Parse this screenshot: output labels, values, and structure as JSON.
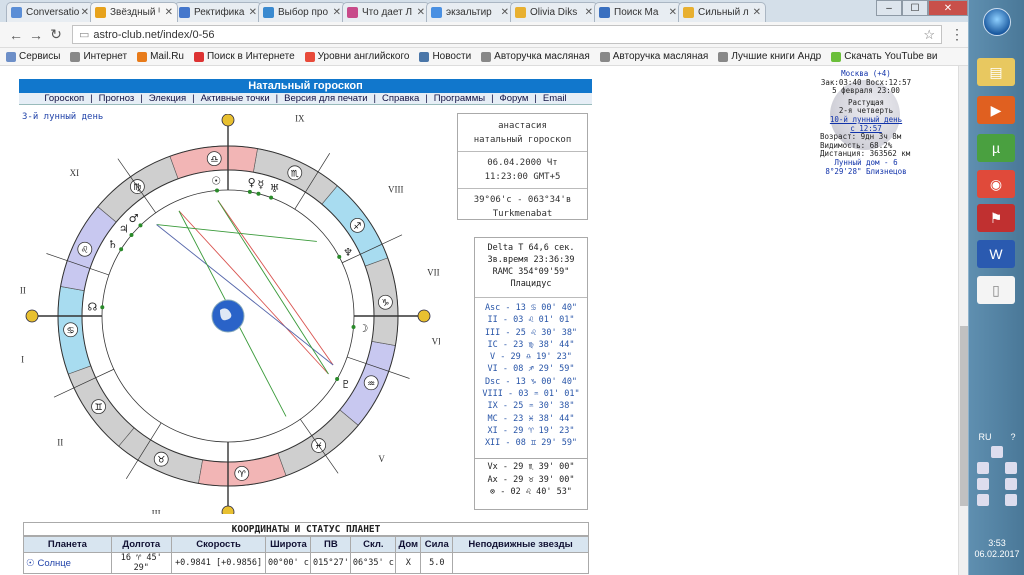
{
  "browser": {
    "tabs": [
      {
        "title": "Conversatio",
        "color": "#5b8ed6",
        "active": false
      },
      {
        "title": "Звёздный ᴵ",
        "color": "#e7a21c",
        "active": true
      },
      {
        "title": "Ректифика",
        "color": "#4477cc",
        "active": false
      },
      {
        "title": "Выбор про",
        "color": "#3a8ad0",
        "active": false
      },
      {
        "title": "Что дает Л",
        "color": "#c84a8a",
        "active": false
      },
      {
        "title": "экзальтир",
        "color": "#4a90e2",
        "active": false
      },
      {
        "title": "Olivia Diks",
        "color": "#e8b030",
        "active": false
      },
      {
        "title": "Поиск Ма",
        "color": "#3a70c0",
        "active": false
      },
      {
        "title": "Сильный л",
        "color": "#e8b030",
        "active": false
      }
    ],
    "url": "astro-club.net/index/0-56",
    "bookmarks": [
      {
        "label": "Сервисы",
        "color": "#6d8fc8"
      },
      {
        "label": "Интернет",
        "color": "#888888"
      },
      {
        "label": "Mail.Ru",
        "color": "#e87b1a"
      },
      {
        "label": "Поиск в Интернете",
        "color": "#d33"
      },
      {
        "label": "Уровни английского",
        "color": "#e84a3a"
      },
      {
        "label": "Новости",
        "color": "#4a76a8"
      },
      {
        "label": "Авторучка масляная",
        "color": "#888888"
      },
      {
        "label": "Авторучка масляная",
        "color": "#888888"
      },
      {
        "label": "Лучшие книги Андр",
        "color": "#888888"
      },
      {
        "label": "Скачать YouTube ви",
        "color": "#6bbf3a"
      }
    ],
    "window_buttons": {
      "minimize": "–",
      "maximize": "☐",
      "close": "✕"
    }
  },
  "page": {
    "title": "Натальный гороскоп",
    "nav": [
      "Гороскоп",
      "Прогноз",
      "Элекция",
      "Активные точки",
      "Версия для печати",
      "Справка",
      "Программы",
      "Форум",
      "Email"
    ],
    "lunar_day": "3-й лунный день",
    "info": {
      "name": "анастасия",
      "type": "натальный гороскоп",
      "date": "06.04.2000 Чт",
      "time": "11:23:00  GMT+5",
      "coords": "39°06'с - 063°34'в",
      "place": "Turkmenabat"
    },
    "delta": {
      "delta_t": "Delta T  64,6 сек.",
      "star_time": "Зв.время 23:36:39",
      "ramc": "RAMC 354°09'59\"",
      "system": "Плацидус"
    },
    "cusps": [
      "Asc - 13 ♋ 00' 40\"",
      "II - 03 ♌ 01' 01\"",
      "III - 25 ♌ 30' 38\"",
      "IC - 23 ♍ 38' 44\"",
      "V - 29 ♎ 19' 23\"",
      "VI - 08 ♐ 29' 59\"",
      "Dsc - 13 ♑ 00' 40\"",
      "VIII - 03 ♒ 01' 01\"",
      "IX - 25 ♒ 30' 38\"",
      "MC - 23 ♓ 38' 44\"",
      "XI - 29 ♈ 19' 23\"",
      "XII - 08 ♊ 29' 59\""
    ],
    "aspects": [
      "Vx - 29 ♏ 39' 00\"",
      "Ax - 29 ♉ 39' 00\"",
      "⊗ - 02 ♌ 40' 53\""
    ],
    "coord_title": "КООРДИНАТЫ И СТАТУС ПЛАНЕТ",
    "coord_headers": [
      "Планета",
      "Долгота",
      "Скорость",
      "Широта",
      "ПВ",
      "Скл.",
      "Дом",
      "Сила",
      "Неподвижные звезды"
    ],
    "coord_rows": [
      {
        "planet": "Солнце",
        "glyph": "☉",
        "lon": "16 ♈ 45' 29\"",
        "speed": "+0.9841 [+0.9856]",
        "lat": "00°00' с",
        "ra": "015°27'",
        "decl": "06°35' с",
        "house": "X",
        "power": "5.0",
        "stars": ""
      }
    ]
  },
  "chart": {
    "houses": [
      "I",
      "II",
      "III",
      "IV",
      "V",
      "VI",
      "VII",
      "VIII",
      "IX",
      "X",
      "XI",
      "XII"
    ],
    "zodiac": [
      "♋",
      "♊",
      "♉",
      "♈",
      "♓",
      "♒",
      "♑",
      "♐",
      "♏",
      "♎",
      "♍",
      "♌"
    ],
    "house_colors": {
      "fire": "#f2b5b5",
      "earth": "#b8e0b8",
      "air": "#c8c8f0",
      "water": "#a8dcf0",
      "grey": "#cfcfcf"
    },
    "markers": [
      "Asc",
      "Dsc",
      "MC",
      "IC"
    ],
    "planets": [
      "♄",
      "♃",
      "♂",
      "♅",
      "♆",
      "☽",
      "♇",
      "☊",
      "☉",
      "♀",
      "☿"
    ],
    "line_colors": {
      "red": "#d9534f",
      "green": "#3a9a3a",
      "blue": "#5566aa"
    }
  },
  "moon": {
    "city": "Москва (+4)",
    "rise_set": "Зак:03:40 Восх:12:57",
    "date": "5 февраля 23:00",
    "phase": "Растущая",
    "quarter": "2-я четверть",
    "lunar_day": "10-й лунный день",
    "since": "с 12:57",
    "age": "Возраст: 9дн 3ч 8м",
    "visibility": "Видимость: 68.2%",
    "distance": "Дистанция: 363562 км",
    "house": "Лунный дом - 6",
    "position": "8°29'28\" Близнецов"
  },
  "taskbar": {
    "lang": "RU",
    "time": "3:53",
    "date": "06.02.2017"
  }
}
